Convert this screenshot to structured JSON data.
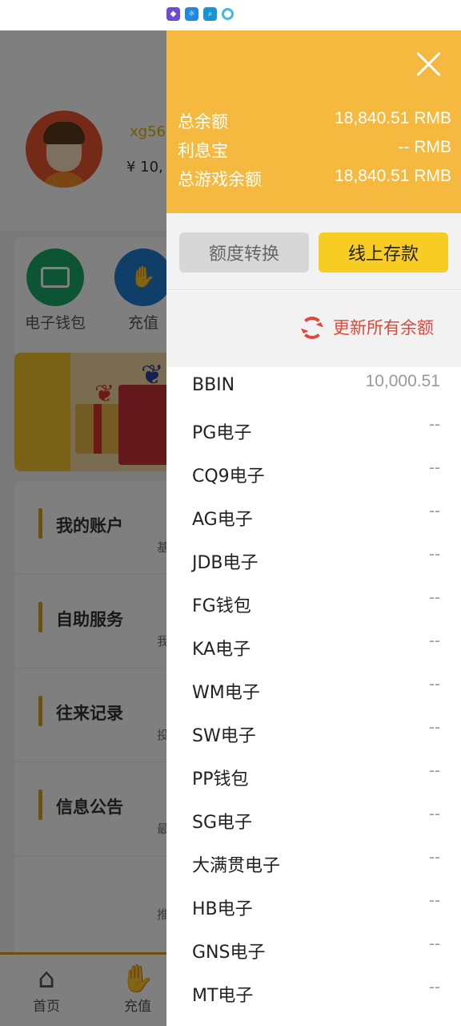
{
  "background_app": {
    "username": "xg56",
    "money": "¥ 10,",
    "quick_items": [
      {
        "label": "电子钱包",
        "icon": "wallet-icon"
      },
      {
        "label": "充值",
        "icon": "deposit-hand-icon"
      }
    ],
    "menu": [
      {
        "title": "我的账户",
        "sub": "基"
      },
      {
        "title": "自助服务",
        "sub": "我"
      },
      {
        "title": "往来记录",
        "sub": "投"
      },
      {
        "title": "信息公告",
        "sub": "最"
      }
    ],
    "menu_footer_sub": "推",
    "tabbar": [
      {
        "label": "首页",
        "icon": "home-icon"
      },
      {
        "label": "充值",
        "icon": "deposit-icon"
      }
    ]
  },
  "drawer": {
    "balances": [
      {
        "label": "总余额",
        "value": "18,840.51 RMB"
      },
      {
        "label": "利息宝",
        "value": "-- RMB"
      },
      {
        "label": "总游戏余额",
        "value": "18,840.51 RMB"
      }
    ],
    "transfer_button": "额度转换",
    "deposit_button": "线上存款",
    "refresh_label": "更新所有余额",
    "games": [
      {
        "name": "BBIN",
        "value": "10,000.51"
      },
      {
        "name": "PG电子",
        "value": "--"
      },
      {
        "name": "CQ9电子",
        "value": "--"
      },
      {
        "name": "AG电子",
        "value": "--"
      },
      {
        "name": "JDB电子",
        "value": "--"
      },
      {
        "name": "FG钱包",
        "value": "--"
      },
      {
        "name": "KA电子",
        "value": "--"
      },
      {
        "name": "WM电子",
        "value": "--"
      },
      {
        "name": "SW电子",
        "value": "--"
      },
      {
        "name": "PP钱包",
        "value": "--"
      },
      {
        "name": "SG电子",
        "value": "--"
      },
      {
        "name": "大满贯电子",
        "value": "--"
      },
      {
        "name": "HB电子",
        "value": "--"
      },
      {
        "name": "GNS电子",
        "value": "--"
      },
      {
        "name": "MT电子",
        "value": "--"
      }
    ]
  },
  "colors": {
    "header": "#f4b93e",
    "deposit_button": "#f7cd24",
    "refresh": "#e2463a"
  }
}
